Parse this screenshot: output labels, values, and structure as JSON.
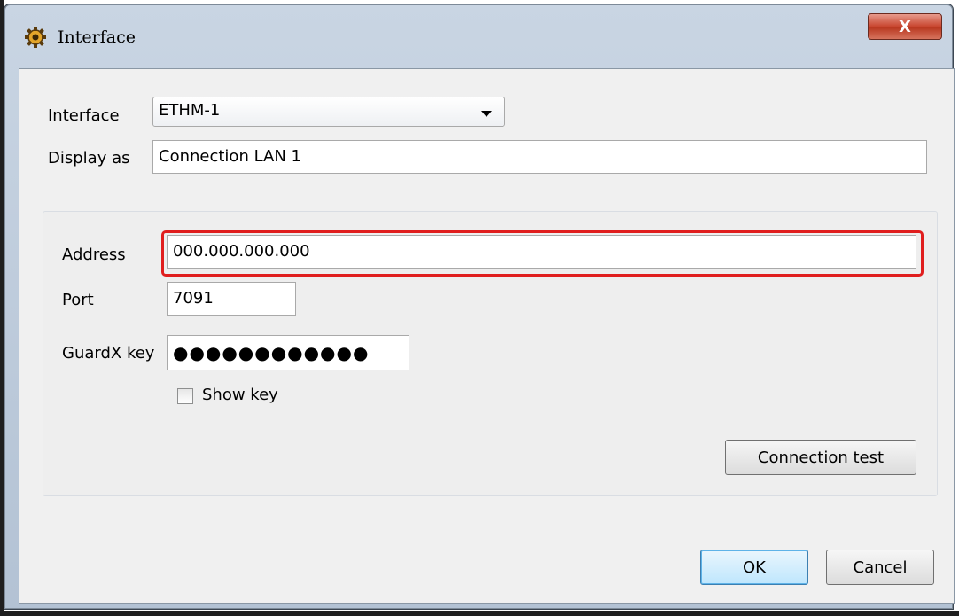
{
  "window": {
    "title": "Interface",
    "close_label": "X"
  },
  "form": {
    "interface_label": "Interface",
    "interface_value": "ETHM-1",
    "display_label": "Display as",
    "display_value": "Connection LAN 1"
  },
  "group": {
    "address_label": "Address",
    "address_value": "000.000.000.000",
    "port_label": "Port",
    "port_value": "7091",
    "key_label": "GuardX key",
    "key_masked": "●●●●●●●●●●●●",
    "show_key_label": "Show key",
    "show_key_checked": false,
    "test_label": "Connection test"
  },
  "buttons": {
    "ok": "OK",
    "cancel": "Cancel"
  },
  "colors": {
    "highlight": "#e01e1e",
    "close_button": "#c8452e",
    "default_button_border": "#3c7fb1"
  },
  "icons": {
    "app": "gear-icon",
    "dropdown": "chevron-down-icon"
  }
}
